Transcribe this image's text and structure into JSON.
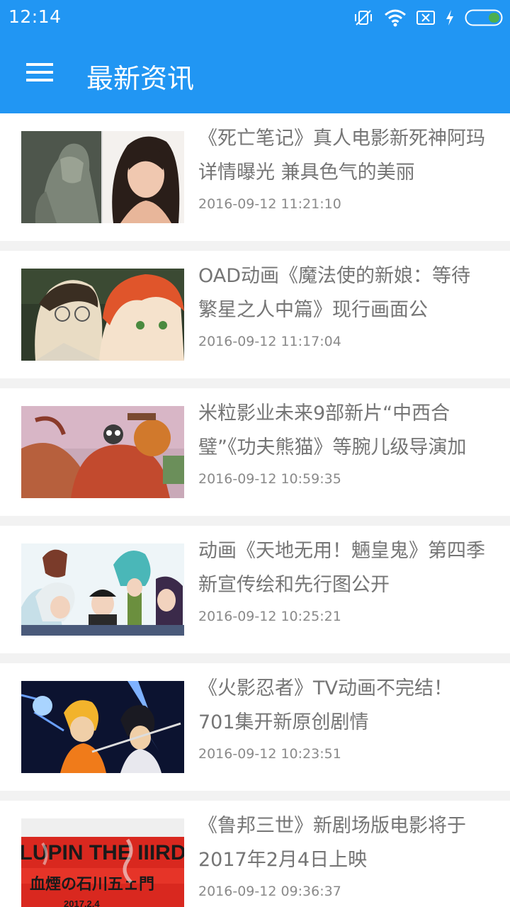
{
  "status_bar": {
    "time": "12:14",
    "icons": [
      "vibrate-off-icon",
      "wifi-icon",
      "sim-icon",
      "charging-icon",
      "battery-icon"
    ],
    "battery_color": "#4caf50"
  },
  "app_bar": {
    "title": "最新资讯",
    "menu_icon": "hamburger-menu-icon",
    "color": "#2196f3"
  },
  "news": [
    {
      "title": "《死亡笔记》真人电影新死神阿玛详情曝光 兼具色气的美丽",
      "time": "2016-09-12 11:21:10"
    },
    {
      "title": "OAD动画《魔法使的新娘：等待繁星之人中篇》现行画面公",
      "time": "2016-09-12 11:17:04"
    },
    {
      "title": "米粒影业未来9部新片“中西合璧”《功夫熊猫》等腕儿级导演加",
      "time": "2016-09-12 10:59:35"
    },
    {
      "title": "动画《天地无用！魎皇鬼》第四季新宣传绘和先行图公开",
      "time": "2016-09-12 10:25:21"
    },
    {
      "title": "《火影忍者》TV动画不完结！701集开新原创剧情",
      "time": "2016-09-12 10:23:51"
    },
    {
      "title": "《鲁邦三世》新剧场版电影将于2017年2月4日上映",
      "time": "2016-09-12 09:36:37"
    }
  ],
  "thumb6": {
    "banner_text": "LUPIN THE IIIRD",
    "subtitle": "血煙の石川五ェ門",
    "date": "2017.2.4"
  }
}
